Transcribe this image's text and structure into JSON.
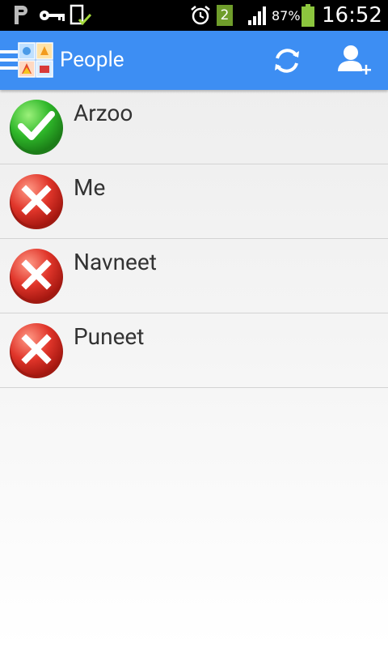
{
  "status_bar": {
    "sim_badge": "2",
    "battery_percent": "87%",
    "time": "16:52"
  },
  "action_bar": {
    "title": "People"
  },
  "people": [
    {
      "name": "Arzoo",
      "status": "online"
    },
    {
      "name": "Me",
      "status": "offline"
    },
    {
      "name": "Navneet",
      "status": "offline"
    },
    {
      "name": "Puneet",
      "status": "offline"
    }
  ],
  "colors": {
    "action_bar": "#3d8ef3",
    "status_online": "#33b52a",
    "status_offline": "#e0352a"
  }
}
